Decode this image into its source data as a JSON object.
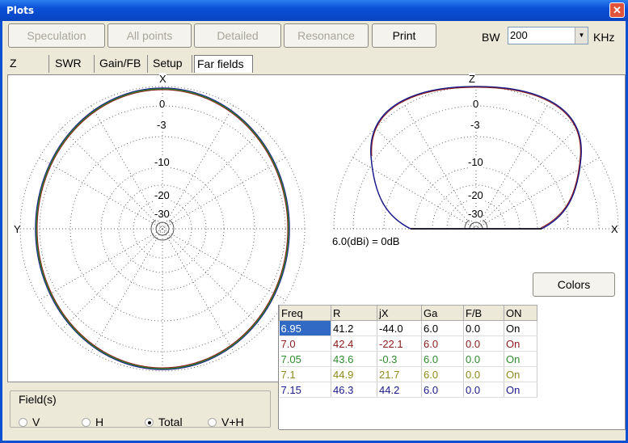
{
  "window": {
    "title": "Plots",
    "close_glyph": "✕"
  },
  "toolbar": {
    "buttons": [
      {
        "label": "Speculation",
        "enabled": false
      },
      {
        "label": "All points",
        "enabled": false
      },
      {
        "label": "Detailed",
        "enabled": false
      },
      {
        "label": "Resonance",
        "enabled": false
      },
      {
        "label": "Print",
        "enabled": true
      }
    ],
    "bw_label": "BW",
    "bw_value": "200",
    "bw_unit": "KHz"
  },
  "tabs": [
    {
      "label": "Z",
      "active": false
    },
    {
      "label": "SWR",
      "active": false
    },
    {
      "label": "Gain/FB",
      "active": false
    },
    {
      "label": "Setup",
      "active": false
    },
    {
      "label": "Far fields",
      "active": true
    }
  ],
  "azimuth_plot": {
    "top_label": "X",
    "left_label": "Y",
    "ring_labels": [
      "0",
      "-3",
      "-10",
      "-20",
      "-30"
    ]
  },
  "elevation_plot": {
    "top_label": "Z",
    "right_label": "X",
    "ring_labels": [
      "0",
      "-3",
      "-10",
      "-20",
      "-30"
    ]
  },
  "reference_text": "6.0(dBi) = 0dB",
  "colors_button": "Colors",
  "fields": {
    "legend": "Field(s)",
    "options": [
      {
        "label": "V",
        "selected": false
      },
      {
        "label": "H",
        "selected": false
      },
      {
        "label": "Total",
        "selected": true
      },
      {
        "label": "V+H",
        "selected": false
      }
    ]
  },
  "table": {
    "columns": [
      "Freq",
      "R",
      "jX",
      "Ga",
      "F/B",
      "ON"
    ],
    "rows": [
      {
        "color": "#ffffff",
        "cells": [
          "6.95",
          "41.2",
          "-44.0",
          "6.0",
          "0.0",
          "On"
        ]
      },
      {
        "color": "#8b1a1a",
        "cells": [
          "7.0",
          "42.4",
          "-22.1",
          "6.0",
          "0.0",
          "On"
        ]
      },
      {
        "color": "#2e8b2e",
        "cells": [
          "7.05",
          "43.6",
          "-0.3",
          "6.0",
          "0.0",
          "On"
        ]
      },
      {
        "color": "#8b8b1a",
        "cells": [
          "7.1",
          "44.9",
          "21.7",
          "6.0",
          "0.0",
          "On"
        ]
      },
      {
        "color": "#1a1a8b",
        "cells": [
          "7.15",
          "46.3",
          "44.2",
          "6.0",
          "0.0",
          "On"
        ]
      }
    ]
  }
}
